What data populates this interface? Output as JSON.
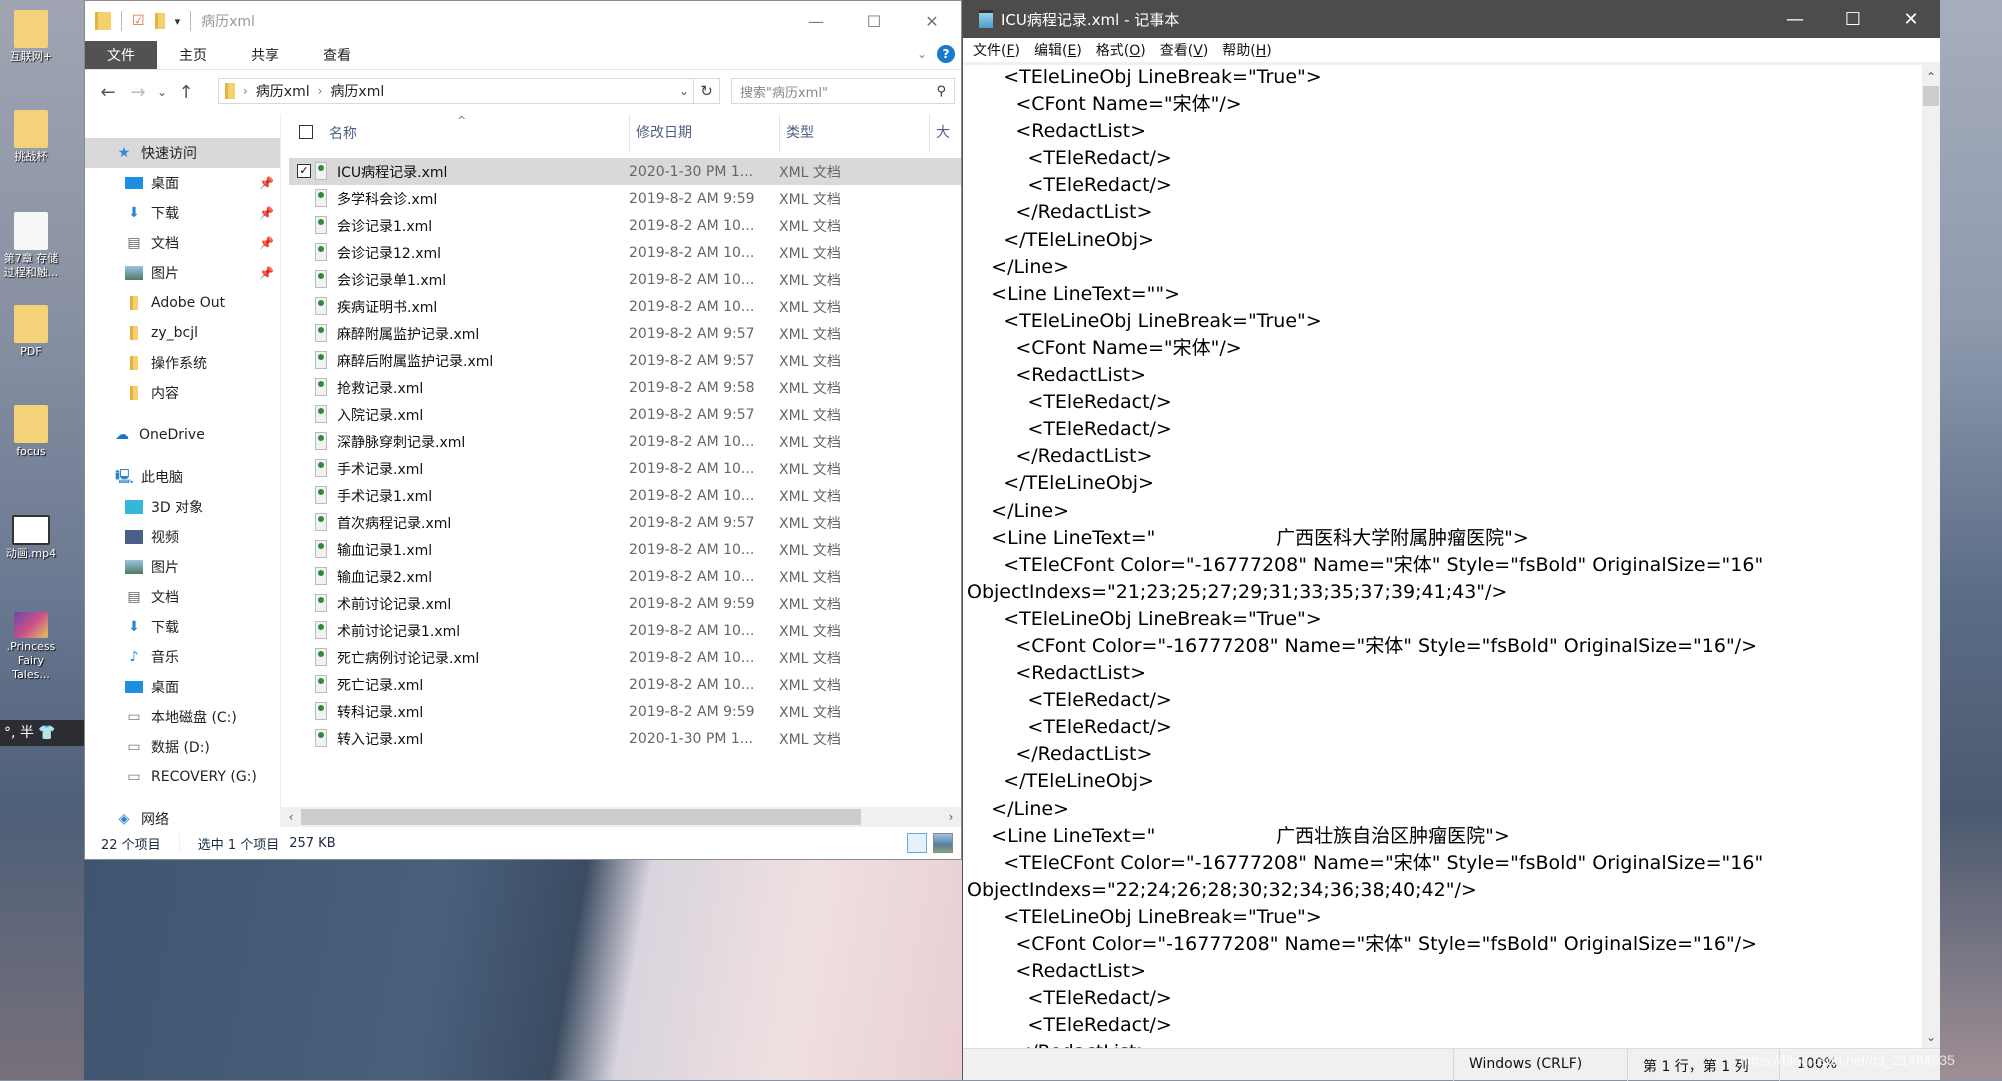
{
  "desktop": {
    "icons": [
      {
        "label": "互联网+",
        "kind": "folder"
      },
      {
        "label": "挑战杯",
        "kind": "folder"
      },
      {
        "label": "第7章 存储过程和触...",
        "kind": "pptx"
      },
      {
        "label": "PDF",
        "kind": "folder"
      },
      {
        "label": "focus",
        "kind": "folder-shortcut"
      },
      {
        "label": "动画.mp4",
        "kind": "video"
      },
      {
        "label": ".Princess Fairy Tales...",
        "kind": "video"
      }
    ],
    "tray_text": "°, 半"
  },
  "explorer": {
    "title": "病历xml",
    "window_buttons": {
      "minimize": "—",
      "maximize": "☐",
      "close": "✕"
    },
    "ribbon_tabs": [
      "文件",
      "主页",
      "共享",
      "查看"
    ],
    "help_label": "?",
    "nav": {
      "back": "←",
      "forward": "→",
      "recent": "⌄",
      "up": "↑"
    },
    "breadcrumb": [
      "病历xml",
      "病历xml"
    ],
    "search_placeholder": "搜索\"病历xml\"",
    "sidebar": {
      "quick_access": {
        "label": "快速访问",
        "items": [
          {
            "label": "桌面",
            "icon": "desktop-icon",
            "pinned": true
          },
          {
            "label": "下载",
            "icon": "download-icon",
            "pinned": true
          },
          {
            "label": "文档",
            "icon": "document-icon",
            "pinned": true
          },
          {
            "label": "图片",
            "icon": "picture-icon",
            "pinned": true
          },
          {
            "label": "Adobe Out",
            "icon": "folder-icon",
            "pinned": false
          },
          {
            "label": "zy_bcjl",
            "icon": "folder-icon",
            "pinned": false
          },
          {
            "label": "操作系统",
            "icon": "folder-icon",
            "pinned": false
          },
          {
            "label": "内容",
            "icon": "folder-icon",
            "pinned": false
          }
        ]
      },
      "onedrive": "OneDrive",
      "this_pc": {
        "label": "此电脑",
        "items": [
          {
            "label": "3D 对象",
            "icon": "3d-objects-icon"
          },
          {
            "label": "视频",
            "icon": "video-icon"
          },
          {
            "label": "图片",
            "icon": "picture-icon"
          },
          {
            "label": "文档",
            "icon": "document-icon"
          },
          {
            "label": "下载",
            "icon": "download-icon"
          },
          {
            "label": "音乐",
            "icon": "music-icon"
          },
          {
            "label": "桌面",
            "icon": "desktop-icon"
          },
          {
            "label": "本地磁盘 (C:)",
            "icon": "system-drive-icon"
          },
          {
            "label": "数据 (D:)",
            "icon": "drive-icon"
          },
          {
            "label": "RECOVERY (G:)",
            "icon": "drive-icon"
          }
        ]
      },
      "network": "网络"
    },
    "columns": {
      "name": "名称",
      "date": "修改日期",
      "type": "类型",
      "size": "大小"
    },
    "files": [
      {
        "name": "ICU病程记录.xml",
        "date": "2020-1-30 PM 1...",
        "type": "XML 文档",
        "selected": true
      },
      {
        "name": "多学科会诊.xml",
        "date": "2019-8-2 AM 9:59",
        "type": "XML 文档"
      },
      {
        "name": "会诊记录1.xml",
        "date": "2019-8-2 AM 10...",
        "type": "XML 文档"
      },
      {
        "name": "会诊记录12.xml",
        "date": "2019-8-2 AM 10...",
        "type": "XML 文档"
      },
      {
        "name": "会诊记录单1.xml",
        "date": "2019-8-2 AM 10...",
        "type": "XML 文档"
      },
      {
        "name": "疾病证明书.xml",
        "date": "2019-8-2 AM 10...",
        "type": "XML 文档"
      },
      {
        "name": "麻醉附属监护记录.xml",
        "date": "2019-8-2 AM 9:57",
        "type": "XML 文档"
      },
      {
        "name": "麻醉后附属监护记录.xml",
        "date": "2019-8-2 AM 9:57",
        "type": "XML 文档"
      },
      {
        "name": "抢救记录.xml",
        "date": "2019-8-2 AM 9:58",
        "type": "XML 文档"
      },
      {
        "name": "入院记录.xml",
        "date": "2019-8-2 AM 9:57",
        "type": "XML 文档"
      },
      {
        "name": "深静脉穿刺记录.xml",
        "date": "2019-8-2 AM 10...",
        "type": "XML 文档"
      },
      {
        "name": "手术记录.xml",
        "date": "2019-8-2 AM 10...",
        "type": "XML 文档"
      },
      {
        "name": "手术记录1.xml",
        "date": "2019-8-2 AM 10...",
        "type": "XML 文档"
      },
      {
        "name": "首次病程记录.xml",
        "date": "2019-8-2 AM 9:57",
        "type": "XML 文档"
      },
      {
        "name": "输血记录1.xml",
        "date": "2019-8-2 AM 10...",
        "type": "XML 文档"
      },
      {
        "name": "输血记录2.xml",
        "date": "2019-8-2 AM 10...",
        "type": "XML 文档"
      },
      {
        "name": "术前讨论记录.xml",
        "date": "2019-8-2 AM 9:59",
        "type": "XML 文档"
      },
      {
        "name": "术前讨论记录1.xml",
        "date": "2019-8-2 AM 10...",
        "type": "XML 文档"
      },
      {
        "name": "死亡病例讨论记录.xml",
        "date": "2019-8-2 AM 10...",
        "type": "XML 文档"
      },
      {
        "name": "死亡记录.xml",
        "date": "2019-8-2 AM 10...",
        "type": "XML 文档"
      },
      {
        "name": "转科记录.xml",
        "date": "2019-8-2 AM 9:59",
        "type": "XML 文档"
      },
      {
        "name": "转入记录.xml",
        "date": "2020-1-30 PM 1...",
        "type": "XML 文档"
      }
    ],
    "status": {
      "count": "22 个项目",
      "selected": "选中 1 个项目",
      "size": "257 KB"
    }
  },
  "notepad": {
    "title": "ICU病程记录.xml - 记事本",
    "window_buttons": {
      "minimize": "—",
      "maximize": "☐",
      "close": "✕"
    },
    "menu": [
      {
        "label": "文件",
        "key": "F"
      },
      {
        "label": "编辑",
        "key": "E"
      },
      {
        "label": "格式",
        "key": "O"
      },
      {
        "label": "查看",
        "key": "V"
      },
      {
        "label": "帮助",
        "key": "H"
      }
    ],
    "lines": [
      "      <TEleLineObj LineBreak=\"True\">",
      "        <CFont Name=\"宋体\"/>",
      "        <RedactList>",
      "          <TEleRedact/>",
      "          <TEleRedact/>",
      "        </RedactList>",
      "      </TEleLineObj>",
      "    </Line>",
      "    <Line LineText=\"\">",
      "      <TEleLineObj LineBreak=\"True\">",
      "        <CFont Name=\"宋体\"/>",
      "        <RedactList>",
      "          <TEleRedact/>",
      "          <TEleRedact/>",
      "        </RedactList>",
      "      </TEleLineObj>",
      "    </Line>",
      "    <Line LineText=\"                    广西医科大学附属肿瘤医院\">",
      "      <TEleCFont Color=\"-16777208\" Name=\"宋体\" Style=\"fsBold\" OriginalSize=\"16\"",
      "ObjectIndexs=\"21;23;25;27;29;31;33;35;37;39;41;43\"/>",
      "      <TEleLineObj LineBreak=\"True\">",
      "        <CFont Color=\"-16777208\" Name=\"宋体\" Style=\"fsBold\" OriginalSize=\"16\"/>",
      "        <RedactList>",
      "          <TEleRedact/>",
      "          <TEleRedact/>",
      "        </RedactList>",
      "      </TEleLineObj>",
      "    </Line>",
      "    <Line LineText=\"                    广西壮族自治区肿瘤医院\">",
      "      <TEleCFont Color=\"-16777208\" Name=\"宋体\" Style=\"fsBold\" OriginalSize=\"16\"",
      "ObjectIndexs=\"22;24;26;28;30;32;34;36;38;40;42\"/>",
      "      <TEleLineObj LineBreak=\"True\">",
      "        <CFont Color=\"-16777208\" Name=\"宋体\" Style=\"fsBold\" OriginalSize=\"16\"/>",
      "        <RedactList>",
      "          <TEleRedact/>",
      "          <TEleRedact/>",
      "        </RedactList>"
    ],
    "status": {
      "line_ending": "Windows (CRLF)",
      "position": "第 1 行，第 1 列",
      "zoom": "100%"
    }
  },
  "watermark": "https://blog.csdn.net/qq_21484935"
}
